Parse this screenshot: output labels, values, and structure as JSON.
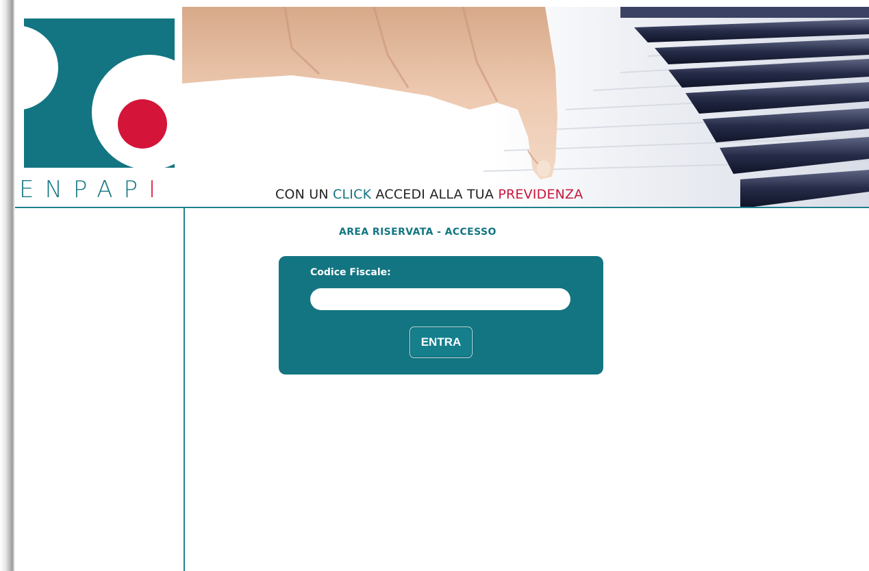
{
  "brand": {
    "logo_text_main": "ENPA",
    "logo_text_last": "I",
    "colors": {
      "teal": "#137582",
      "red": "#d5143a"
    }
  },
  "header": {
    "tagline": {
      "part1": "CON UN ",
      "click": "CLICK",
      "part2": " ACCEDI ALLA TUA ",
      "previdenza": "PREVIDENZA"
    }
  },
  "main": {
    "title": "AREA RISERVATA - ACCESSO",
    "login": {
      "codice_fiscale_label": "Codice Fiscale:",
      "codice_fiscale_value": "",
      "submit_label": "ENTRA"
    }
  }
}
